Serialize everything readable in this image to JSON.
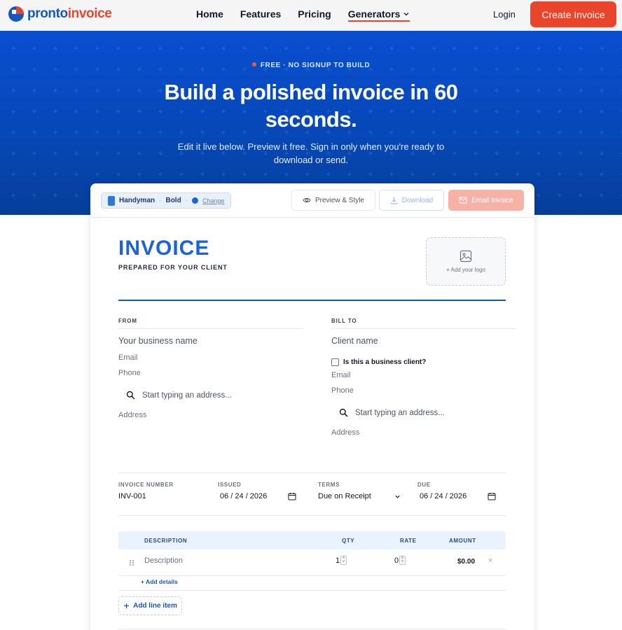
{
  "nav": {
    "logo_a": "pronto",
    "logo_b": "invoice",
    "links": [
      "Home",
      "Features",
      "Pricing",
      "Generators"
    ],
    "login": "Login",
    "cta": "Create Invoice"
  },
  "hero": {
    "badge": "FREE · NO SIGNUP TO BUILD",
    "title_line1": "Build a polished invoice in 60",
    "title_line2": "seconds.",
    "subtitle": "Edit it live below. Preview it free. Sign in only when you're ready to download or send."
  },
  "toolbar": {
    "template": "Handyman",
    "sep1": "·",
    "style": "Bold",
    "sep2": "·",
    "change": "Change",
    "preview": "Preview & Style",
    "download": "Download",
    "email": "Email Invoice"
  },
  "invoice": {
    "title": "INVOICE",
    "prepared": "PREPARED FOR YOUR CLIENT",
    "logo_label": "+ Add your logo",
    "from": {
      "label": "FROM",
      "name_placeholder": "Your business name",
      "email": "Email",
      "phone": "Phone",
      "address_search": "Start typing an address...",
      "address": "Address"
    },
    "bill_to": {
      "label": "BILL TO",
      "name_placeholder": "Client name",
      "business_check": "Is this a business client?",
      "email": "Email",
      "phone": "Phone",
      "address_search": "Start typing an address...",
      "address": "Address"
    },
    "meta": {
      "number_label": "INVOICE NUMBER",
      "number": "INV-001",
      "issued_label": "ISSUED",
      "issued": "06 / 24 / 2026",
      "terms_label": "TERMS",
      "terms": "Due on Receipt",
      "due_label": "DUE",
      "due": "06 / 24 / 2026"
    },
    "table": {
      "headers": [
        "DESCRIPTION",
        "QTY",
        "RATE",
        "AMOUNT"
      ],
      "row": {
        "description": "Description",
        "qty": "1",
        "rate": "0",
        "amount": "$0.00",
        "remove": "×"
      },
      "add_details": "+ Add details",
      "add_line": "Add line item"
    }
  },
  "colors": {
    "brand_blue": "#1557c0",
    "brand_red": "#e8452c",
    "hero_blue": "#0a4ed0"
  }
}
